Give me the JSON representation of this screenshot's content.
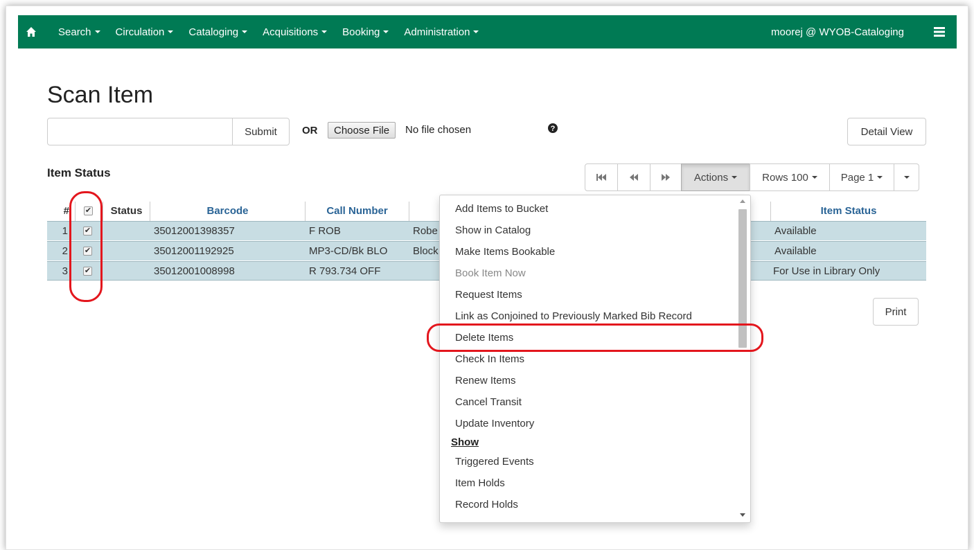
{
  "navbar": {
    "items": [
      {
        "label": "Search"
      },
      {
        "label": "Circulation"
      },
      {
        "label": "Cataloging"
      },
      {
        "label": "Acquisitions"
      },
      {
        "label": "Booking"
      },
      {
        "label": "Administration"
      }
    ],
    "user": "moorej @ WYOB-Cataloging",
    "brand_color": "#007a54"
  },
  "page": {
    "title": "Scan Item",
    "submit_label": "Submit",
    "or_label": "OR",
    "choose_file_label": "Choose File",
    "no_file_label": "No file chosen",
    "detail_view_label": "Detail View",
    "section_title": "Item Status",
    "print_label": "Print"
  },
  "toolbar": {
    "actions_label": "Actions",
    "rows_label": "Rows 100",
    "page_label": "Page 1"
  },
  "table": {
    "columns": [
      "#",
      "Status",
      "Barcode",
      "Call Number",
      "Item Status"
    ],
    "rows": [
      {
        "num": "1",
        "barcode": "35012001398357",
        "call_number": "F ROB",
        "title_fragment": "Robe",
        "item_status": "Available",
        "checked": true
      },
      {
        "num": "2",
        "barcode": "35012001192925",
        "call_number": "MP3-CD/Bk BLO",
        "title_fragment": "Block",
        "item_status": "Available",
        "checked": true
      },
      {
        "num": "3",
        "barcode": "35012001008998",
        "call_number": "R 793.734 OFF",
        "title_fragment": "",
        "item_status": "For Use in Library Only",
        "checked": true
      }
    ]
  },
  "actions_menu": {
    "items": [
      {
        "label": "Add Items to Bucket",
        "disabled": false
      },
      {
        "label": "Show in Catalog",
        "disabled": false
      },
      {
        "label": "Make Items Bookable",
        "disabled": false
      },
      {
        "label": "Book Item Now",
        "disabled": true
      },
      {
        "label": "Request Items",
        "disabled": false
      },
      {
        "label": "Link as Conjoined to Previously Marked Bib Record",
        "disabled": false
      },
      {
        "label": "Delete Items",
        "disabled": false
      },
      {
        "label": "Check In Items",
        "disabled": false
      },
      {
        "label": "Renew Items",
        "disabled": false
      },
      {
        "label": "Cancel Transit",
        "disabled": false
      },
      {
        "label": "Update Inventory",
        "disabled": false
      }
    ],
    "show_header": "Show",
    "show_items": [
      {
        "label": "Triggered Events"
      },
      {
        "label": "Item Holds"
      },
      {
        "label": "Record Holds"
      }
    ]
  },
  "highlight_color": "#e3161d"
}
